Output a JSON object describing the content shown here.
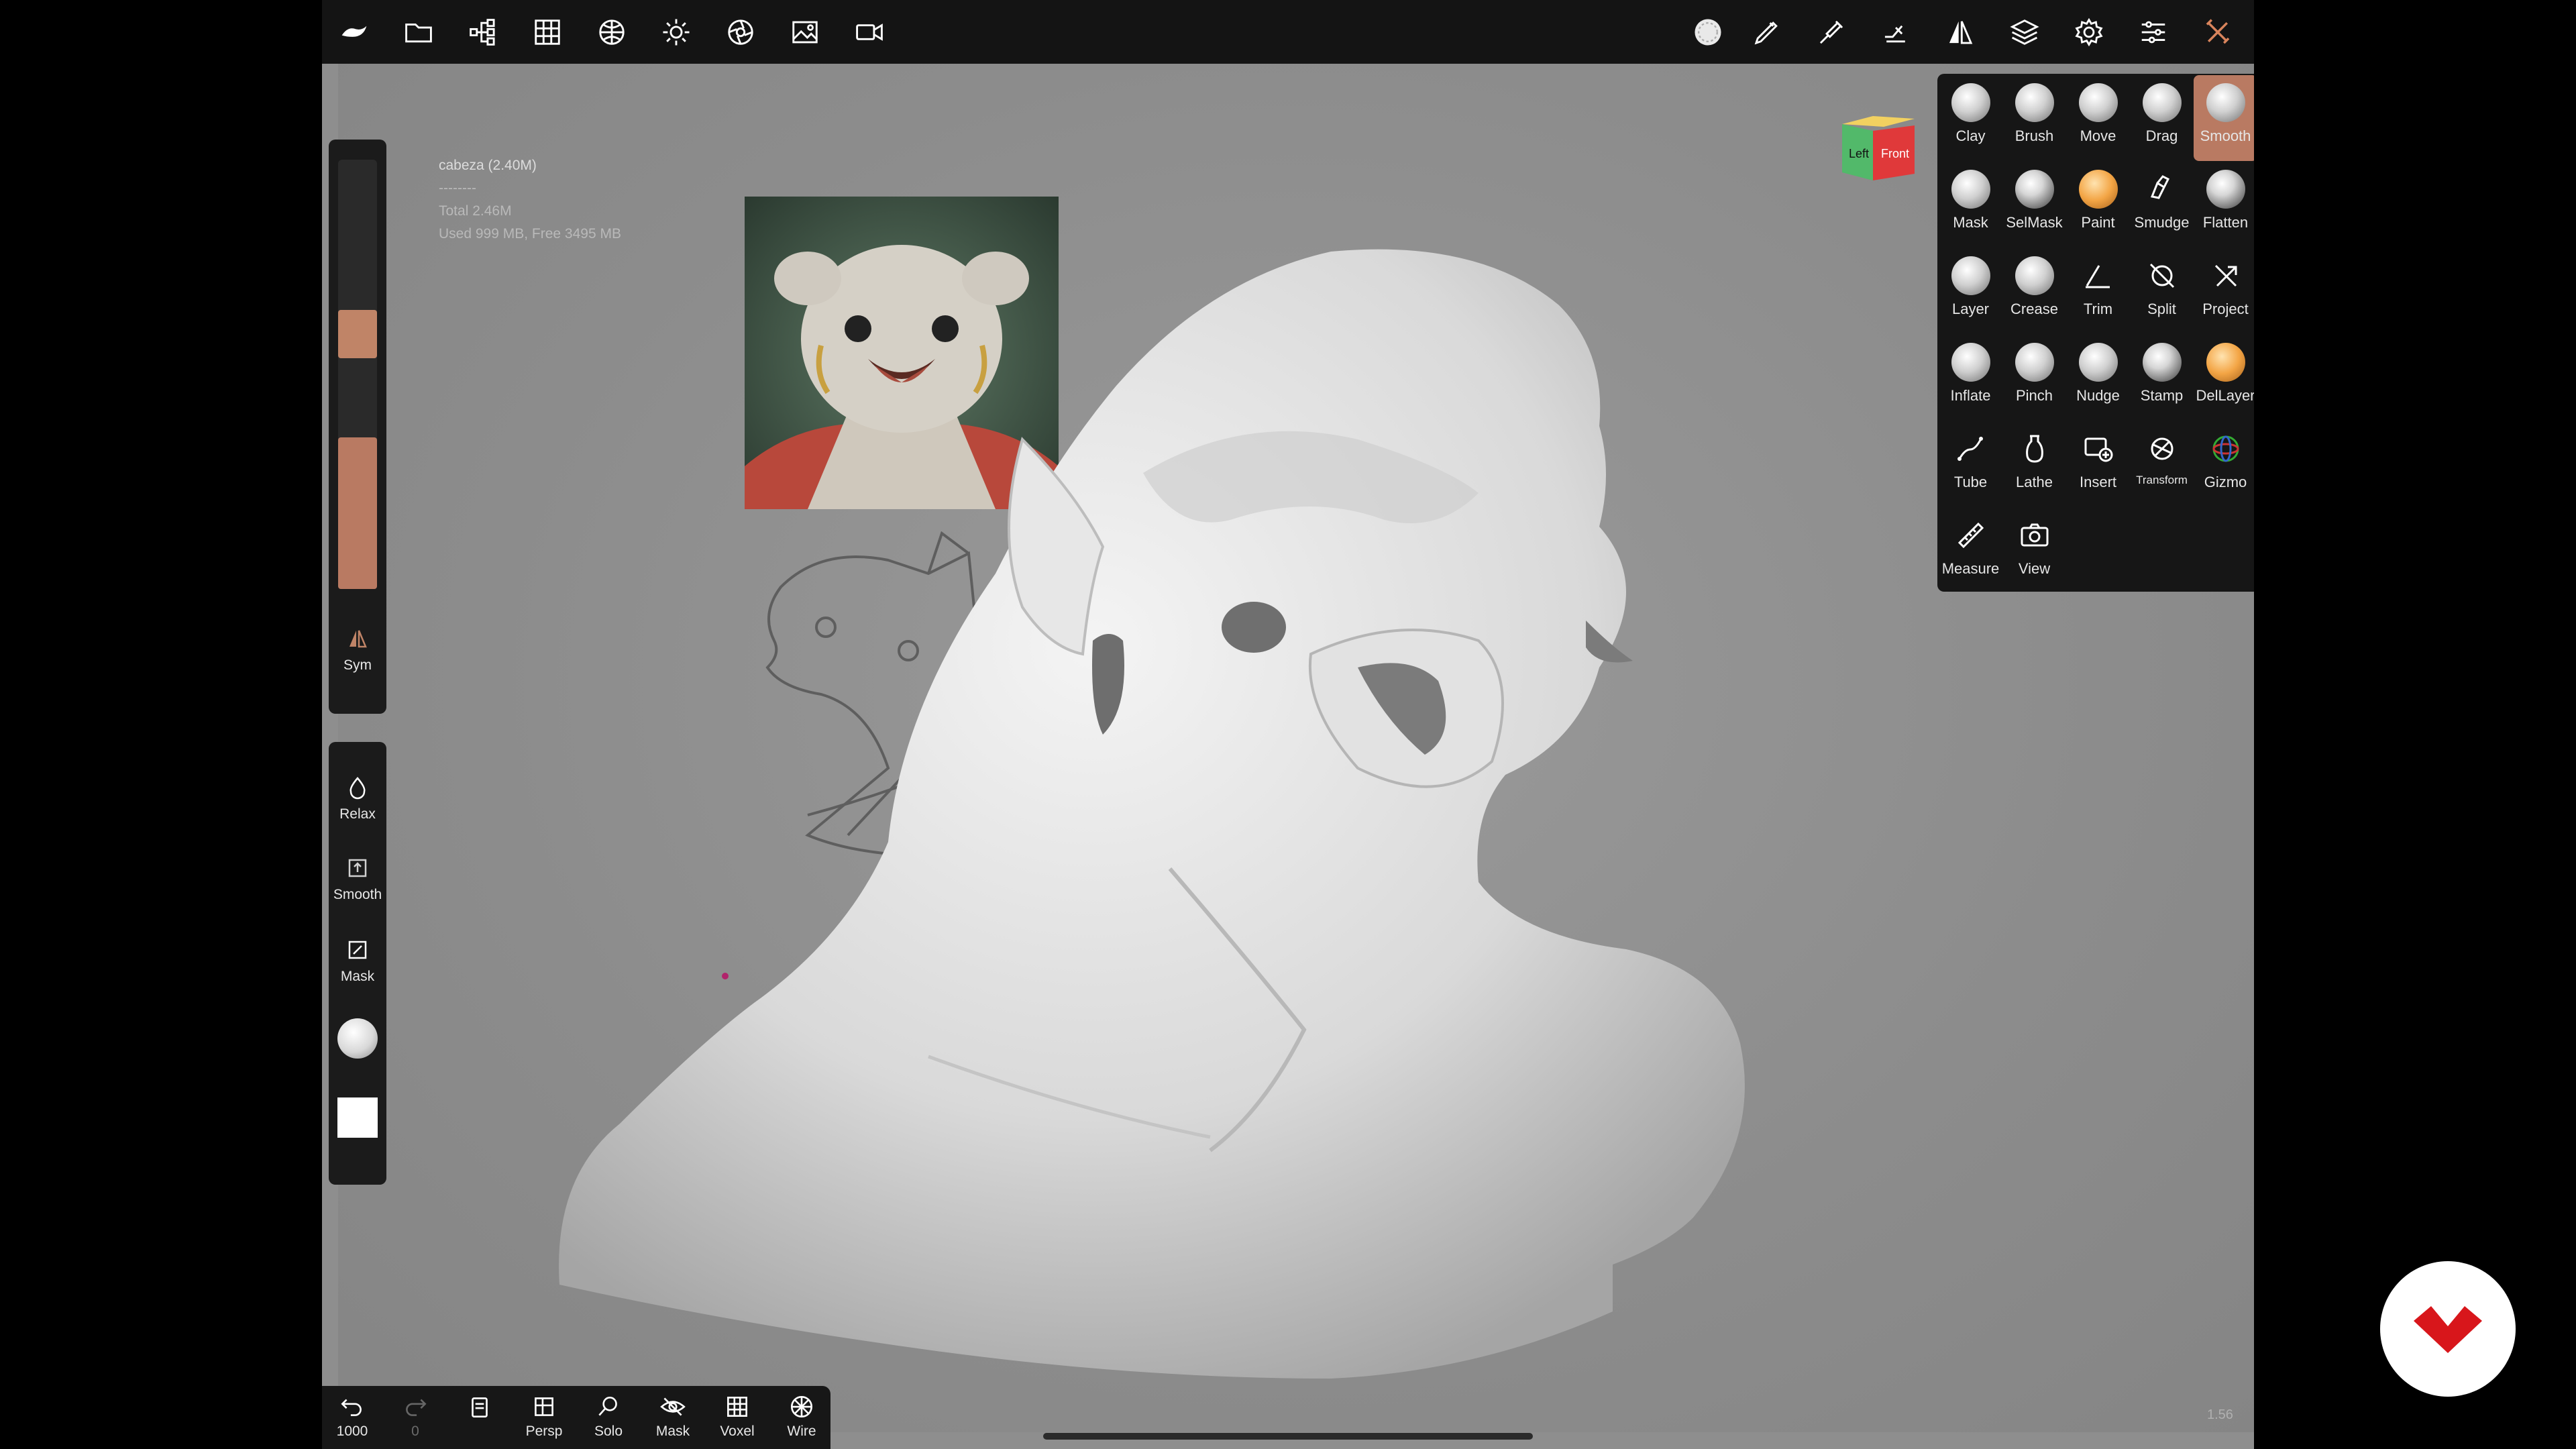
{
  "topbar": {
    "left_icons": [
      "nomad-logo-icon",
      "folder-icon",
      "scene-tree-icon",
      "grid-icon",
      "material-sphere-icon",
      "light-icon",
      "render-settings-icon",
      "image-icon",
      "video-icon"
    ],
    "right_icons": [
      "brush-preview-icon",
      "stroke-icon",
      "tool-settings-icon",
      "paint-icon",
      "symmetry-icon",
      "layers-icon",
      "gear-icon",
      "sliders-icon",
      "close-tools-icon"
    ]
  },
  "stats": {
    "mesh": "cabeza (2.40M)",
    "sep": "--------",
    "total": "Total 2.46M",
    "memory": "Used 999 MB,  Free 3495 MB"
  },
  "left_panel": {
    "brush_color": "#c08467",
    "sym_label": "Sym",
    "relax_label": "Relax",
    "smooth_label": "Smooth",
    "mask_label": "Mask"
  },
  "view_cube": {
    "left": "Left",
    "front": "Front"
  },
  "tools": [
    {
      "label": "Clay",
      "icon": "clay-icon",
      "style": "ball"
    },
    {
      "label": "Brush",
      "icon": "brush-icon",
      "style": "ball"
    },
    {
      "label": "Move",
      "icon": "move-icon",
      "style": "ball"
    },
    {
      "label": "Drag",
      "icon": "drag-icon",
      "style": "ball"
    },
    {
      "label": "Smooth",
      "icon": "smooth-icon",
      "style": "ball",
      "active": true
    },
    {
      "label": "Mask",
      "icon": "mask-icon",
      "style": "ball"
    },
    {
      "label": "SelMask",
      "icon": "selmask-icon",
      "style": "dark"
    },
    {
      "label": "Paint",
      "icon": "paint-icon",
      "style": "orange"
    },
    {
      "label": "Smudge",
      "icon": "smudge-icon",
      "style": "line"
    },
    {
      "label": "Flatten",
      "icon": "flatten-icon",
      "style": "dark"
    },
    {
      "label": "Layer",
      "icon": "layer-icon",
      "style": "ball"
    },
    {
      "label": "Crease",
      "icon": "crease-icon",
      "style": "ball"
    },
    {
      "label": "Trim",
      "icon": "trim-icon",
      "style": "line"
    },
    {
      "label": "Split",
      "icon": "split-icon",
      "style": "line"
    },
    {
      "label": "Project",
      "icon": "project-icon",
      "style": "line"
    },
    {
      "label": "Inflate",
      "icon": "inflate-icon",
      "style": "ball"
    },
    {
      "label": "Pinch",
      "icon": "pinch-icon",
      "style": "ball"
    },
    {
      "label": "Nudge",
      "icon": "nudge-icon",
      "style": "ball"
    },
    {
      "label": "Stamp",
      "icon": "stamp-icon",
      "style": "dark"
    },
    {
      "label": "DelLayer",
      "icon": "dellayer-icon",
      "style": "orange"
    },
    {
      "label": "Tube",
      "icon": "tube-icon",
      "style": "line"
    },
    {
      "label": "Lathe",
      "icon": "lathe-icon",
      "style": "line"
    },
    {
      "label": "Insert",
      "icon": "insert-icon",
      "style": "line"
    },
    {
      "label": "Transform",
      "icon": "transform-icon",
      "style": "line",
      "small": true
    },
    {
      "label": "Gizmo",
      "icon": "gizmo-icon",
      "style": "line"
    },
    {
      "label": "Measure",
      "icon": "measure-icon",
      "style": "line"
    },
    {
      "label": "View",
      "icon": "camera-icon",
      "style": "line"
    }
  ],
  "bottombar": {
    "undo_count": "1000",
    "redo_count": "0",
    "persp": "Persp",
    "solo": "Solo",
    "mask": "Mask",
    "voxel": "Voxel",
    "wire": "Wire"
  },
  "version": "1.56"
}
